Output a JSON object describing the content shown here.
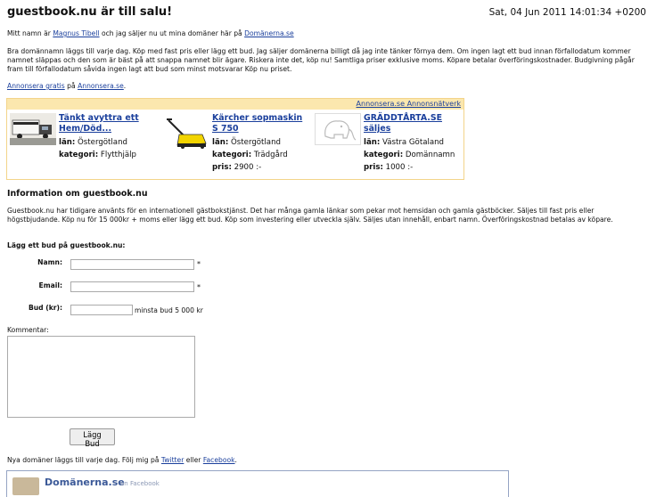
{
  "header": {
    "title": "guestbook.nu är till salu!",
    "datetime": "Sat, 04 Jun 2011 14:01:34 +0200"
  },
  "intro": {
    "prefix": "Mitt namn är ",
    "owner_link": "Magnus Tibell",
    "middle": " och jag säljer nu ut mina domäner här på ",
    "site_link": "Domänerna.se"
  },
  "description": "Bra domännamn läggs till varje dag. Köp med fast pris eller lägg ett bud. Jag säljer domänerna billigt då jag inte tänker förnya dem. Om ingen lagt ett bud innan förfallodatum kommer namnet släppas och den som är bäst på att snappa namnet blir ägare. Riskera inte det, köp nu! Samtliga priser exklusive moms. Köpare betalar överföringskostnader. Budgivning pågår fram till förfallodatum såvida ingen lagt att bud som minst motsvarar Köp nu priset.",
  "advertise": {
    "link1": "Annonsera gratis",
    "middle": " på ",
    "link2": "Annonsera.se",
    "end": "."
  },
  "adnetwork": {
    "header_link": "Annonsera.se Annonsnätverk",
    "lan_label": "län:",
    "kategori_label": "kategori:",
    "pris_label": "pris:",
    "ads": [
      {
        "title": "Tänkt avyttra ett Hem/Död...",
        "lan": "Östergötland",
        "kategori": "Flytthjälp",
        "pris": ""
      },
      {
        "title": "Kärcher sopmaskin S 750",
        "lan": "Östergötland",
        "kategori": "Trädgård",
        "pris": "2900 :-"
      },
      {
        "title": "GRÄDDTÅRTA.SE säljes",
        "lan": "Västra Götaland",
        "kategori": "Domännamn",
        "pris": "1000 :-"
      }
    ]
  },
  "info": {
    "heading": "Information om guestbook.nu",
    "text": "Guestbook.nu har tidigare använts för en internationell gästbokstjänst. Det har många gamla länkar som pekar mot hemsidan och gamla gästböcker. Säljes till fast pris eller högstbjudande. Köp nu för 15 000kr + moms eller lägg ett bud. Köp som investering eller utveckla själv. Säljes utan innehåll, enbart namn. Överföringskostnad betalas av köpare."
  },
  "bid_form": {
    "heading": "Lägg ett bud på guestbook.nu:",
    "name_label": "Namn:",
    "email_label": "Email:",
    "bid_label": "Bud (kr):",
    "required_marker": "*",
    "min_bid_note": "minsta bud 5 000 kr",
    "comment_label": "Kommentar:",
    "submit_label": "Lägg Bud",
    "name_value": "",
    "email_value": "",
    "bid_value": "",
    "comment_value": ""
  },
  "footer": {
    "prefix": "Nya domäner läggs till varje dag. Följ mig på ",
    "twitter": "Twitter",
    "middle": " eller ",
    "facebook": "Facebook",
    "end": "."
  },
  "facebook_box": {
    "name": "Domänerna.se",
    "on": "on Facebook"
  }
}
